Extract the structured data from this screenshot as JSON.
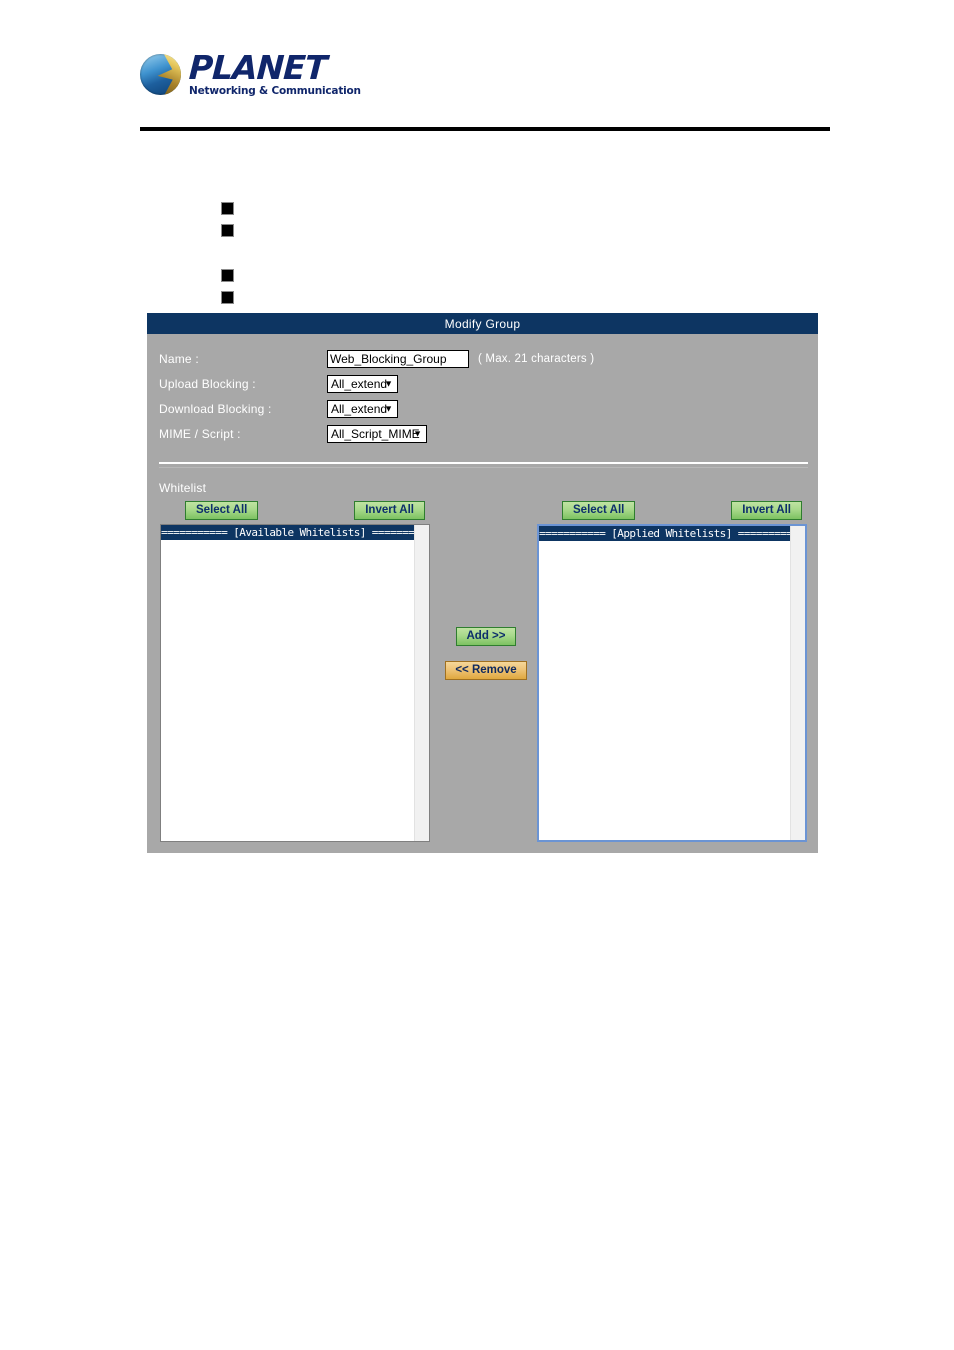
{
  "brand": {
    "name": "PLANET",
    "tagline": "Networking & Communication",
    "logo_icon": "planet-globe-icon"
  },
  "bullets": [
    "",
    "",
    "",
    ""
  ],
  "dialog": {
    "title": "Modify Group",
    "fields": {
      "name": {
        "label": "Name :",
        "value": "Web_Blocking_Group",
        "placeholder": "",
        "hint": "( Max. 21 characters )"
      },
      "upload_blocking": {
        "label": "Upload Blocking :",
        "value": "All_extend"
      },
      "download_blocking": {
        "label": "Download Blocking :",
        "value": "All_extend"
      },
      "mime_script": {
        "label": "MIME / Script :",
        "value": "All_Script_MIME"
      }
    },
    "whitelist": {
      "section_label": "Whitelist",
      "available": {
        "select_all_label": "Select All",
        "invert_all_label": "Invert All",
        "header": "=========== [Available Whitelists] ==========",
        "items": []
      },
      "applied": {
        "select_all_label": "Select All",
        "invert_all_label": "Invert All",
        "header": "=========== [Applied Whitelists] ==========",
        "items": []
      },
      "add_label": "Add >>",
      "remove_label": "<< Remove"
    }
  },
  "colors": {
    "panel_bg": "#a8a8a8",
    "title_bar": "#0d3562",
    "green_button": "#a8d98b",
    "orange_button": "#eec377",
    "brand_blue": "#10266b",
    "focus_border": "#6b94d4"
  }
}
